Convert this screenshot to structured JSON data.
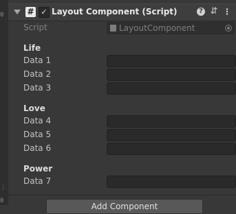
{
  "component": {
    "title": "Layout Component (Script)",
    "enabled_check": "✓",
    "script_icon_glyph": "#",
    "help_icon": "?",
    "presets_icon": "⇵",
    "menu_icon": "⋮"
  },
  "script_row": {
    "label": "Script",
    "value": "LayoutComponent"
  },
  "sections": {
    "life": {
      "header": "Life",
      "fields": [
        {
          "label": "Data 1",
          "value": ""
        },
        {
          "label": "Data 2",
          "value": ""
        },
        {
          "label": "Data 3",
          "value": ""
        }
      ]
    },
    "love": {
      "header": "Love",
      "fields": [
        {
          "label": "Data 4",
          "value": ""
        },
        {
          "label": "Data 5",
          "value": ""
        },
        {
          "label": "Data 6",
          "value": ""
        }
      ]
    },
    "power": {
      "header": "Power",
      "fields": [
        {
          "label": "Data 7",
          "value": ""
        }
      ]
    }
  },
  "add_component_label": "Add Component",
  "colors": {
    "background": "#383838",
    "field": "#2a2a2a",
    "header": "#3e3e3e"
  }
}
